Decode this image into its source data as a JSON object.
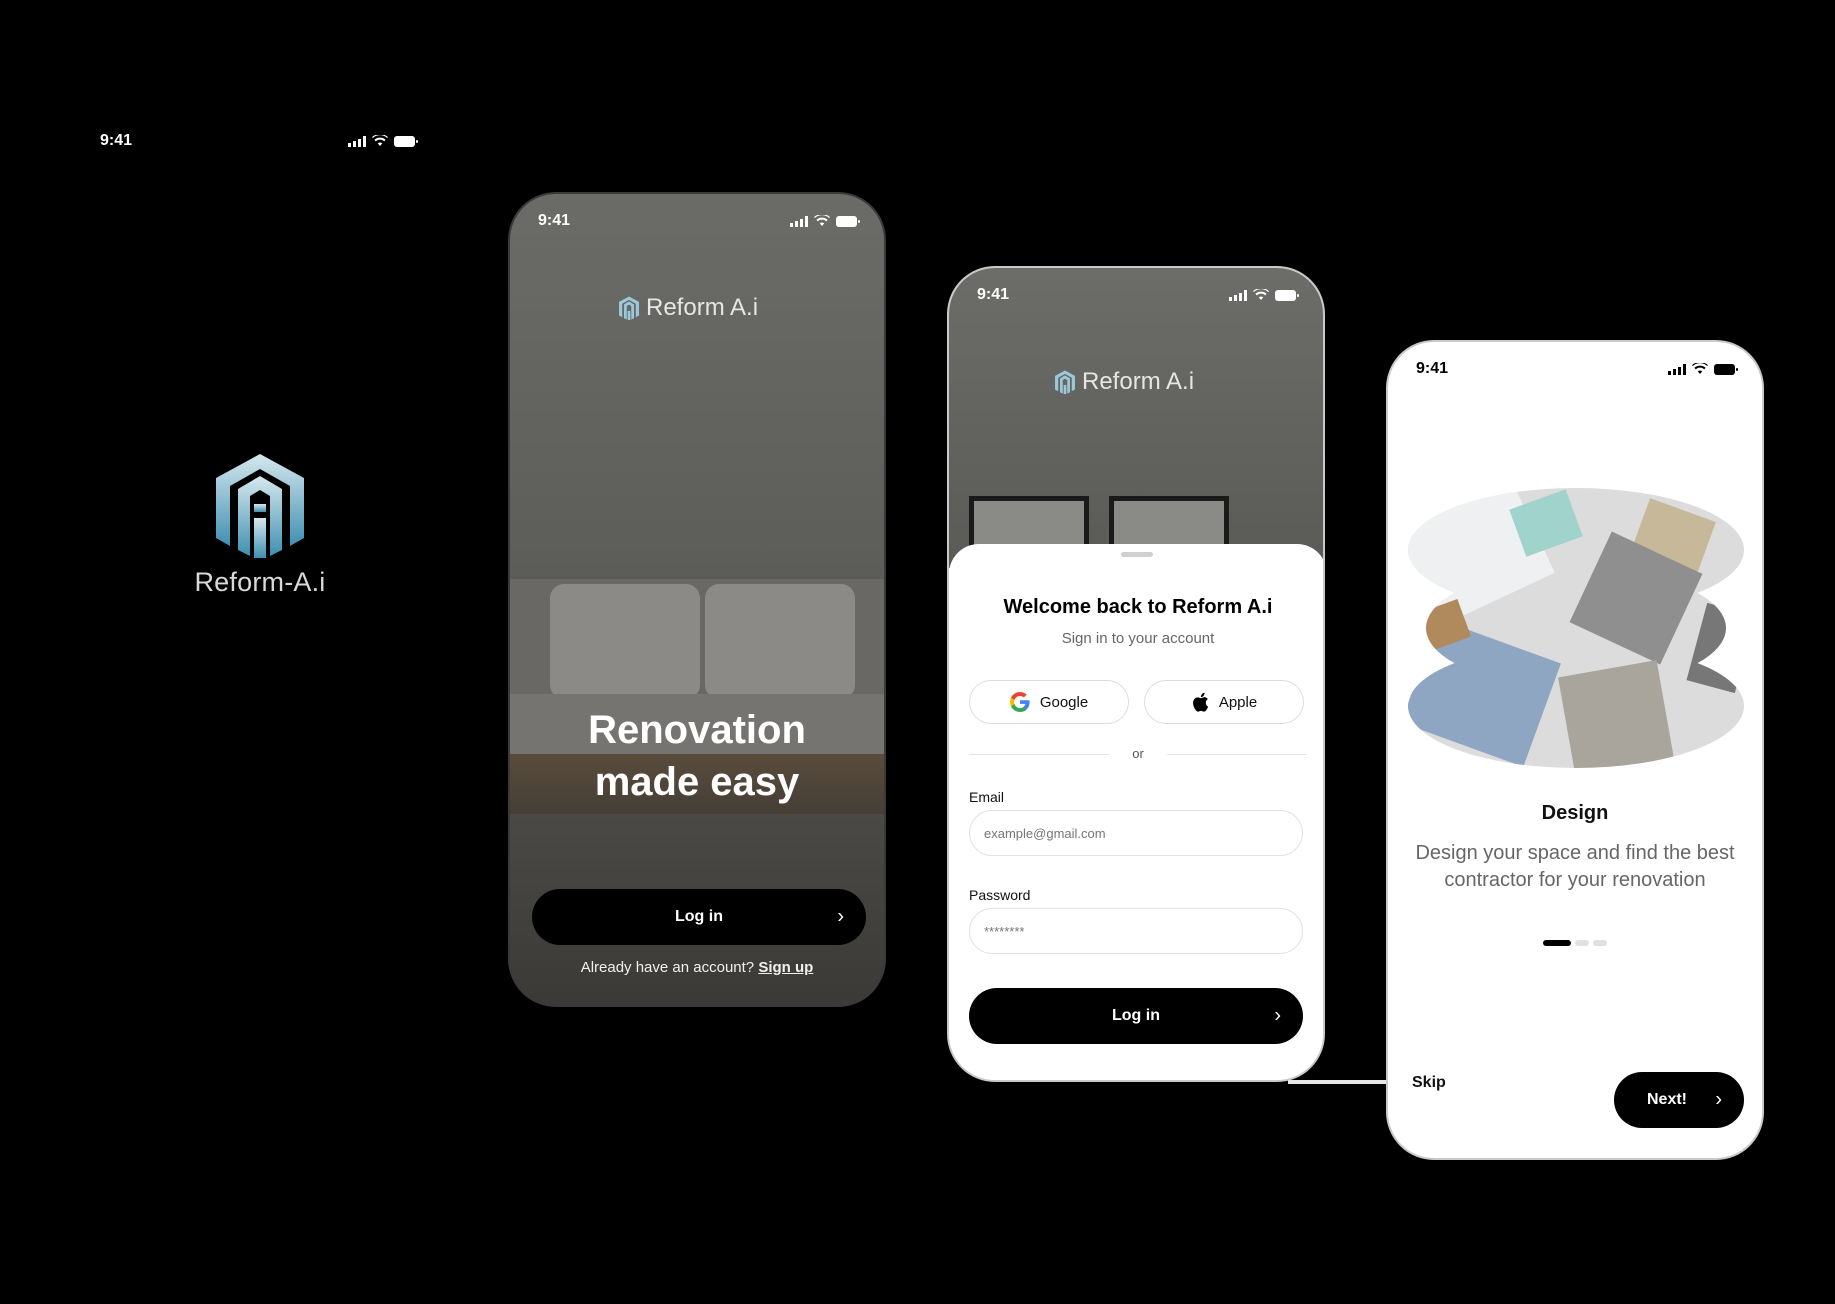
{
  "splash": {
    "time": "9:41",
    "brand": "Reform-A.i"
  },
  "welcome_screen": {
    "time": "9:41",
    "brand": "Reform A.i",
    "hero_title_line1": "Renovation",
    "hero_title_line2": "made easy",
    "login_label": "Log in",
    "footer_text": "Already have an account?",
    "signup_link": "Sign up"
  },
  "login_screen": {
    "time": "9:41",
    "brand": "Reform A.i",
    "title": "Welcome back to Reform A.i",
    "subtitle": "Sign in to your account",
    "google_label": "Google",
    "apple_label": "Apple",
    "divider_text": "or",
    "email_label": "Email",
    "email_placeholder": "example@gmail.com",
    "password_label": "Password",
    "password_placeholder": "********",
    "login_label": "Log in"
  },
  "onboarding_screen": {
    "time": "9:41",
    "title": "Design",
    "description": "Design your space and find the best contractor for your renovation",
    "skip_label": "Skip",
    "next_label": "Next!",
    "page_index": 1,
    "page_count": 3
  },
  "colors": {
    "accent_dark": "#000000",
    "logo_gradient_top": "#cfe3ea",
    "logo_gradient_bottom": "#3f8fb1"
  }
}
